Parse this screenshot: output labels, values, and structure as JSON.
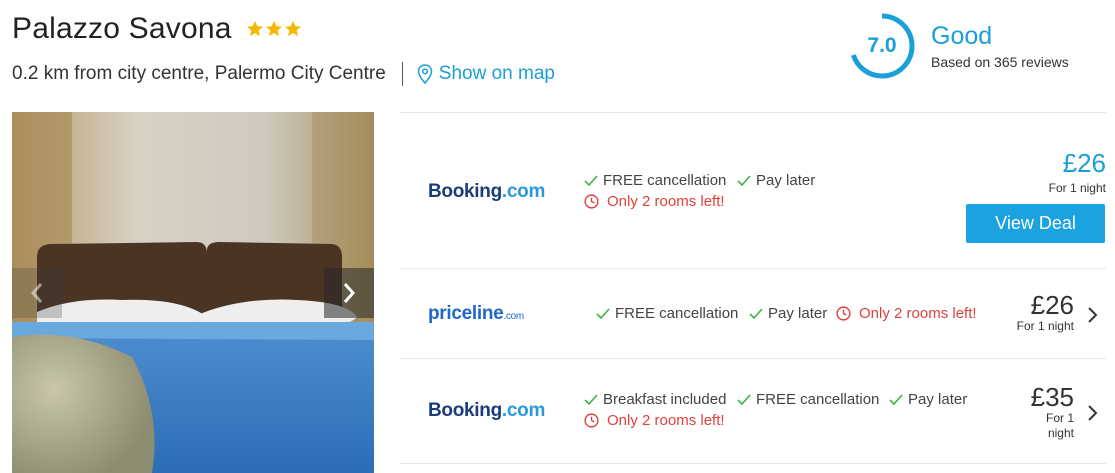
{
  "hotel": {
    "name": "Palazzo Savona",
    "star_count": 3,
    "location": "0.2 km from city centre, Palermo City Centre",
    "map_link": "Show on map"
  },
  "rating": {
    "score": "7.0",
    "score_fraction": 0.7,
    "word": "Good",
    "reviews": "Based on 365 reviews"
  },
  "photo": {
    "prev_icon": "chevron-left-icon",
    "next_icon": "chevron-right-icon"
  },
  "deals": [
    {
      "provider_a": "Booking",
      "provider_b": ".com",
      "features": [
        "FREE cancellation",
        "Pay later"
      ],
      "warning": "Only 2 rooms left!",
      "price": "£26",
      "price_note": "For 1 night",
      "cta": "View Deal"
    },
    {
      "provider_a": "priceline",
      "provider_b": ".com",
      "features": [
        "FREE cancellation",
        "Pay later"
      ],
      "warning": "Only 2 rooms left!",
      "price": "£26",
      "price_note": "For 1 night"
    },
    {
      "provider_a": "Booking",
      "provider_b": ".com",
      "features": [
        "Breakfast included",
        "FREE cancellation",
        "Pay later"
      ],
      "warning": "Only 2 rooms left!",
      "price": "£35",
      "price_note_a": "For 1",
      "price_note_b": "night"
    }
  ],
  "colors": {
    "accent": "#1a9fd8",
    "check": "#3fb24a",
    "warning": "#e0413c",
    "star": "#f5b800"
  }
}
